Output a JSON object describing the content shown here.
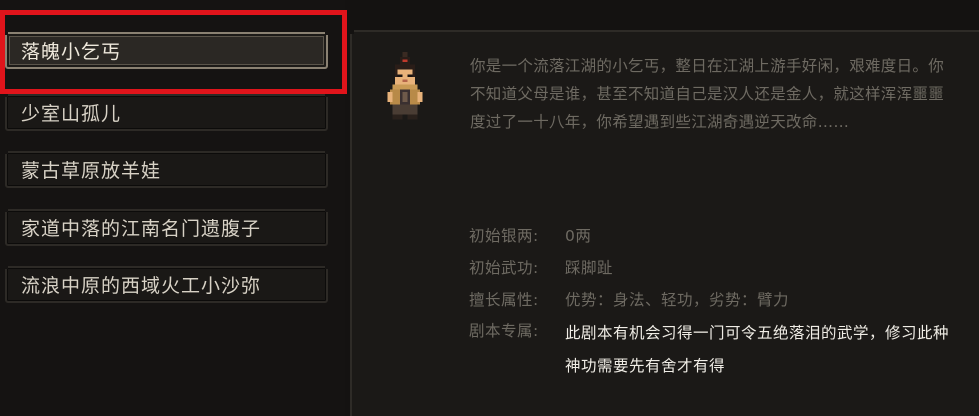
{
  "backgrounds": [
    {
      "label": "落魄小乞丐",
      "selected": true
    },
    {
      "label": "少室山孤儿",
      "selected": false
    },
    {
      "label": "蒙古草原放羊娃",
      "selected": false
    },
    {
      "label": "家道中落的江南名门遗腹子",
      "selected": false
    },
    {
      "label": "流浪中原的西域火工小沙弥",
      "selected": false
    }
  ],
  "detail": {
    "portrait_icon": "beggar-character-sprite",
    "description": "你是一个流落江湖的小乞丐，整日在江湖上游手好闲，艰难度日。你不知道父母是谁，甚至不知道自己是汉人还是金人，就这样浑浑噩噩度过了一十八年，你希望遇到些江湖奇遇逆天改命……",
    "stats": {
      "silver_label": "初始银两:",
      "silver_value": "0两",
      "martial_label": "初始武功:",
      "martial_value": "踩脚趾",
      "attr_label": "擅长属性:",
      "attr_value": "优势：身法、轻功，劣势：臂力",
      "script_label": "剧本专属:",
      "script_value": "此剧本有机会习得一门可令五绝落泪的武学，修习此种神功需要先有舍才有得"
    }
  },
  "colors": {
    "highlight": "#e0141b",
    "selected_border": "#8a8172",
    "panel_bg": "#1b1917"
  }
}
